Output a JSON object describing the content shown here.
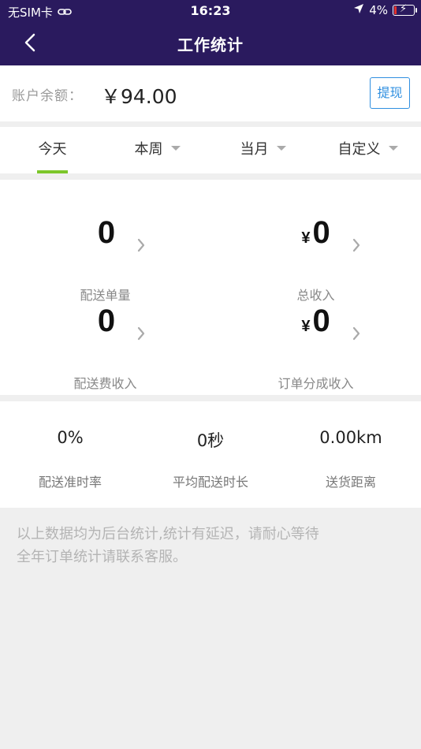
{
  "status_bar": {
    "carrier": "无SIM卡",
    "time": "16:23",
    "battery": "4%",
    "icons": [
      "wifi-link-icon",
      "location-arrow-icon",
      "battery-charging-icon"
    ]
  },
  "nav": {
    "title": "工作统计",
    "back_icon": "chevron-left-icon"
  },
  "balance": {
    "label": "账户余额：",
    "value": "￥94.00",
    "withdraw_label": "提现"
  },
  "tabs": [
    {
      "label": "今天",
      "active": true,
      "dropdown": false
    },
    {
      "label": "本周",
      "active": false,
      "dropdown": true
    },
    {
      "label": "当月",
      "active": false,
      "dropdown": true
    },
    {
      "label": "自定义",
      "active": false,
      "dropdown": true
    }
  ],
  "stats": [
    {
      "value": "0",
      "currency": "",
      "label": "配送单量"
    },
    {
      "value": "0",
      "currency": "¥",
      "label": "总收入"
    },
    {
      "value": "0",
      "currency": "",
      "label": "配送费收入"
    },
    {
      "value": "0",
      "currency": "¥",
      "label": "订单分成收入"
    }
  ],
  "metrics": [
    {
      "value": "0%",
      "label": "配送准时率"
    },
    {
      "value": "0秒",
      "label": "平均配送时长"
    },
    {
      "value": "0.00km",
      "label": "送货距离"
    }
  ],
  "notes": {
    "line1": "以上数据均为后台统计,统计有延迟，请耐心等待",
    "line2": "全年订单统计请联系客服。"
  },
  "colors": {
    "header_bg": "#2a1a5e",
    "accent_green": "#7cc62a",
    "button_blue": "#2f8fe0"
  }
}
